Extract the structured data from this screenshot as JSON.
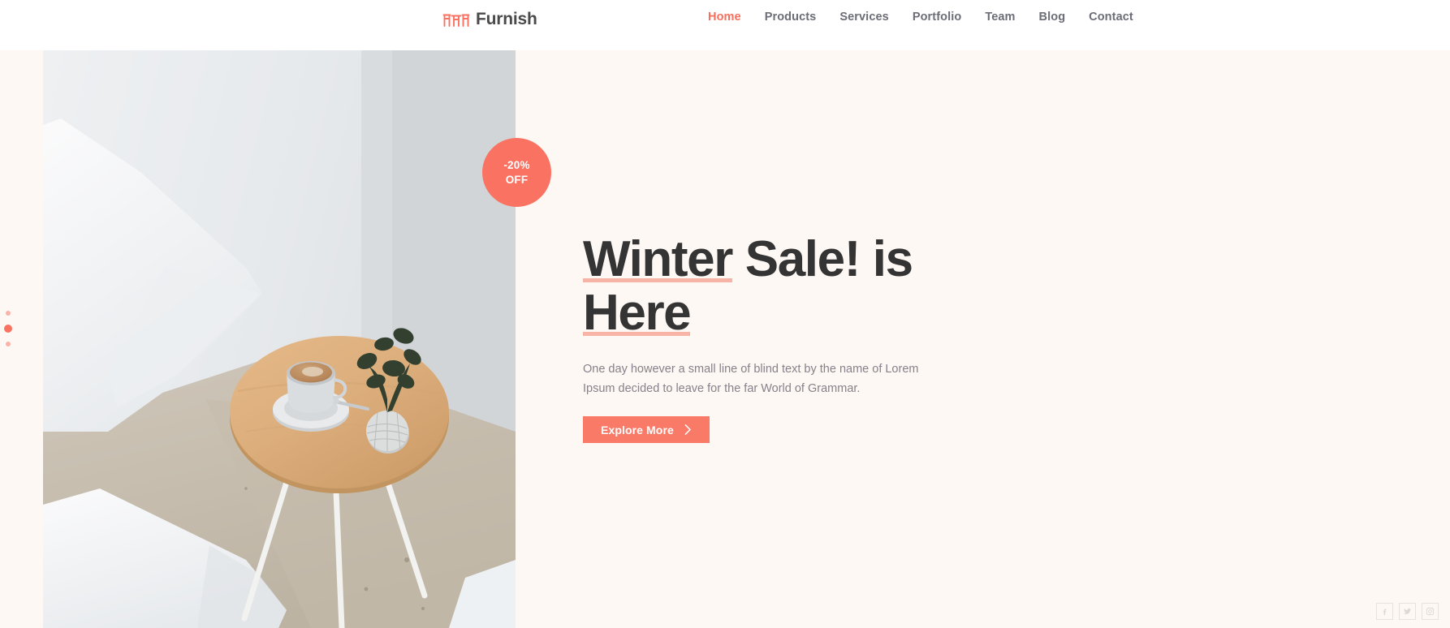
{
  "header": {
    "brand": {
      "name": "Furnish",
      "icon": "table-chairs-icon",
      "color": "#fa7262"
    },
    "nav": [
      {
        "label": "Home",
        "active": true
      },
      {
        "label": "Products",
        "active": false
      },
      {
        "label": "Services",
        "active": false
      },
      {
        "label": "Portfolio",
        "active": false
      },
      {
        "label": "Team",
        "active": false
      },
      {
        "label": "Blog",
        "active": false
      },
      {
        "label": "Contact",
        "active": false
      }
    ]
  },
  "hero": {
    "background_color": "#fef8f4",
    "badge": {
      "discount": "-20%",
      "suffix": "OFF",
      "color": "#fa7262"
    },
    "title_line1_underlined": "Winter",
    "title_line1_rest": " Sale! is",
    "title_line2_underlined": "Here",
    "underline_color": "#f7b3a6",
    "description": "One day however a small line of blind text by the name of Lorem Ipsum decided to leave for the far World of Grammar.",
    "cta": {
      "label": "Explore More",
      "icon": "chevron-right-icon",
      "color": "#fa7a68"
    },
    "photo_alt": "round wooden side table with latte cup and small vase beside white chairs"
  },
  "slider": {
    "dots": [
      {
        "index": 1,
        "active": false
      },
      {
        "index": 2,
        "active": true
      },
      {
        "index": 3,
        "active": false
      }
    ]
  },
  "socials": [
    {
      "name": "facebook-icon",
      "label": "Facebook"
    },
    {
      "name": "twitter-icon",
      "label": "Twitter"
    },
    {
      "name": "instagram-icon",
      "label": "Instagram"
    }
  ]
}
